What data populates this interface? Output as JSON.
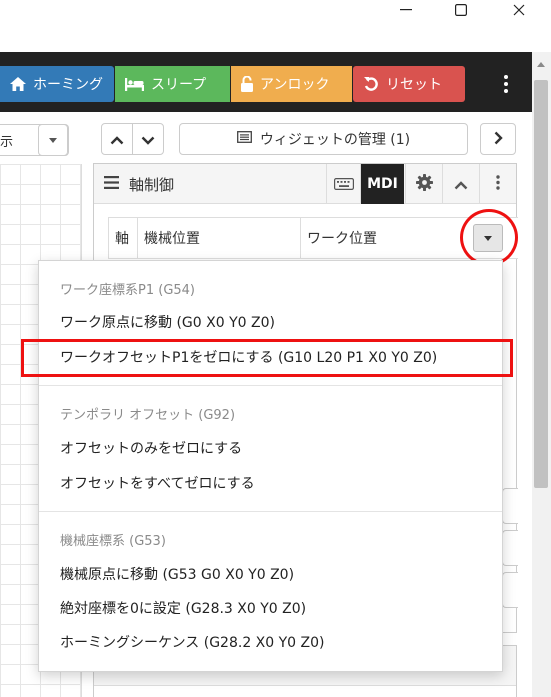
{
  "window": {
    "controls": [
      "minimize-icon",
      "maximize-icon",
      "close-icon"
    ]
  },
  "toolbar": {
    "homing_label": "ホーミング",
    "sleep_label": "スリープ",
    "unlock_label": "アンロック",
    "reset_label": "リセット",
    "colors": {
      "homing": "#337ab7",
      "sleep": "#5cb85c",
      "unlock": "#f0ad4e",
      "reset": "#d9534f",
      "bar": "#222222"
    }
  },
  "left_panel": {
    "select_text": "表示"
  },
  "header_row": {
    "widget_manager_label": "ウィジェットの管理 (1)"
  },
  "axes_widget": {
    "title": "軸制御",
    "mdi_label": "MDI",
    "columns": [
      "軸",
      "機械位置",
      "ワーク位置"
    ]
  },
  "dropdown": {
    "sections": [
      {
        "header": "ワーク座標系P1 (G54)",
        "items": [
          "ワーク原点に移動 (G0 X0 Y0 Z0)",
          "ワークオフセットP1をゼロにする (G10 L20 P1 X0 Y0 Z0)"
        ]
      },
      {
        "header": "テンポラリ オフセット (G92)",
        "items": [
          "オフセットのみをゼロにする",
          "オフセットをすべてゼロにする"
        ]
      },
      {
        "header": "機械座標系 (G53)",
        "items": [
          "機械原点に移動 (G53 G0 X0 Y0 Z0)",
          "絶対座標を0に設定 (G28.3 X0 Y0 Z0)",
          "ホーミングシーケンス (G28.2 X0 Y0 Z0)"
        ]
      }
    ],
    "highlight_color": "#e11111"
  }
}
